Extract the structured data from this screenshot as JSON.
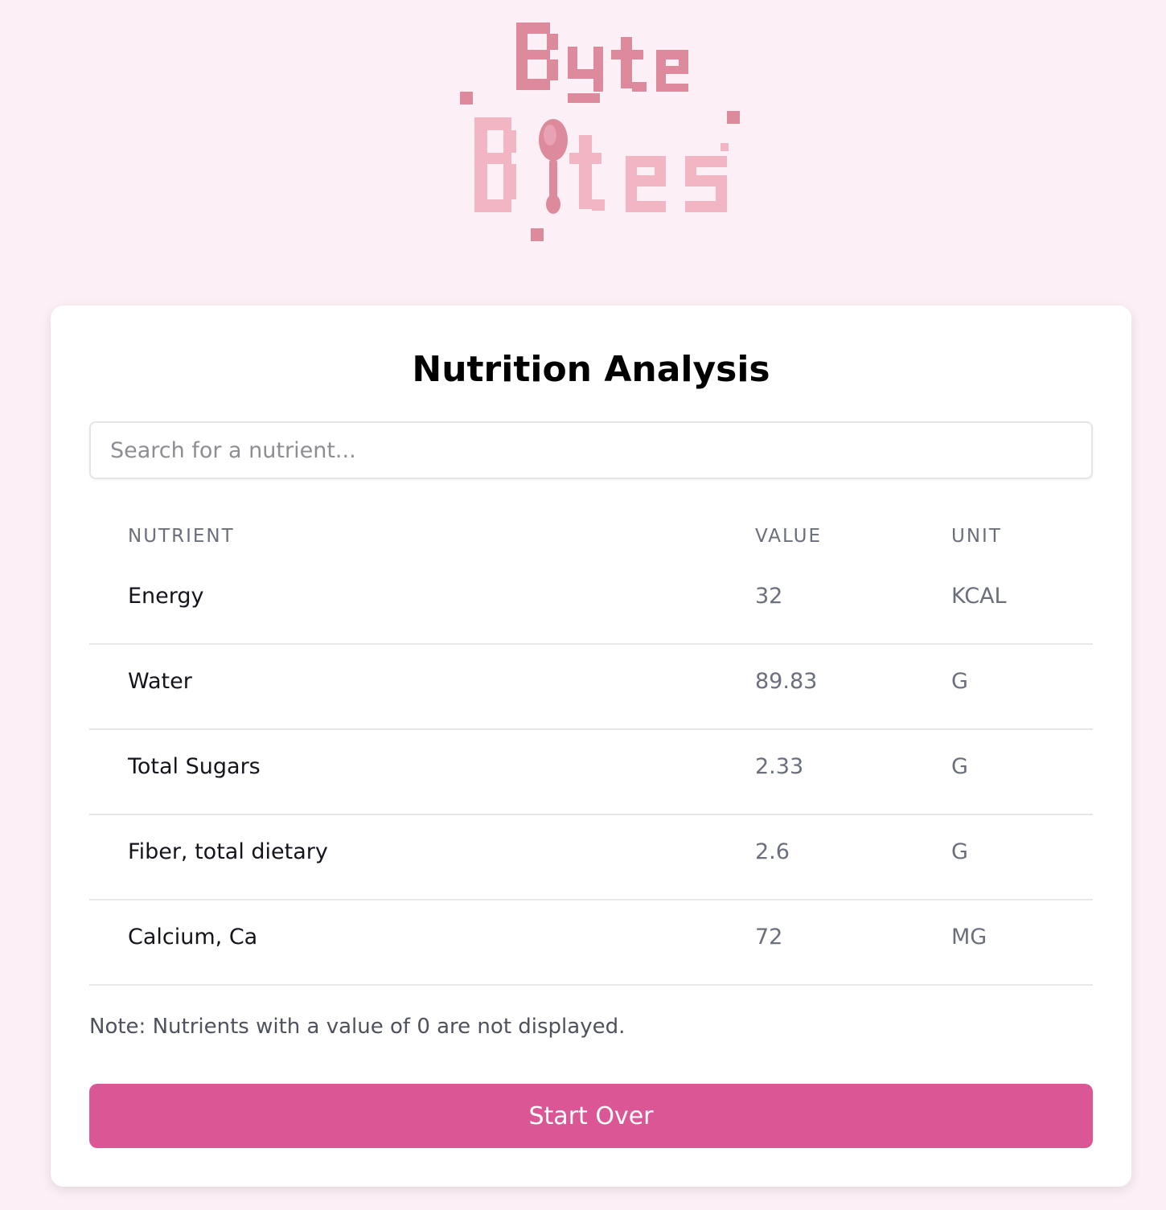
{
  "logo": {
    "line1": "Byte",
    "line2": "Bites"
  },
  "title": "Nutrition Analysis",
  "search": {
    "placeholder": "Search for a nutrient..."
  },
  "table": {
    "headers": {
      "nutrient": "NUTRIENT",
      "value": "VALUE",
      "unit": "UNIT"
    },
    "rows": [
      {
        "nutrient": "Energy",
        "value": "32",
        "unit": "KCAL"
      },
      {
        "nutrient": "Water",
        "value": "89.83",
        "unit": "G"
      },
      {
        "nutrient": "Total Sugars",
        "value": "2.33",
        "unit": "G"
      },
      {
        "nutrient": "Fiber, total dietary",
        "value": "2.6",
        "unit": "G"
      },
      {
        "nutrient": "Calcium, Ca",
        "value": "72",
        "unit": "MG"
      }
    ]
  },
  "note": "Note: Nutrients with a value of 0 are not displayed.",
  "start_over_label": "Start Over",
  "colors": {
    "background": "#fcf0f6",
    "accent": "#da5695",
    "logo_dark": "#dd8a9c",
    "logo_light": "#f2b5c3"
  }
}
